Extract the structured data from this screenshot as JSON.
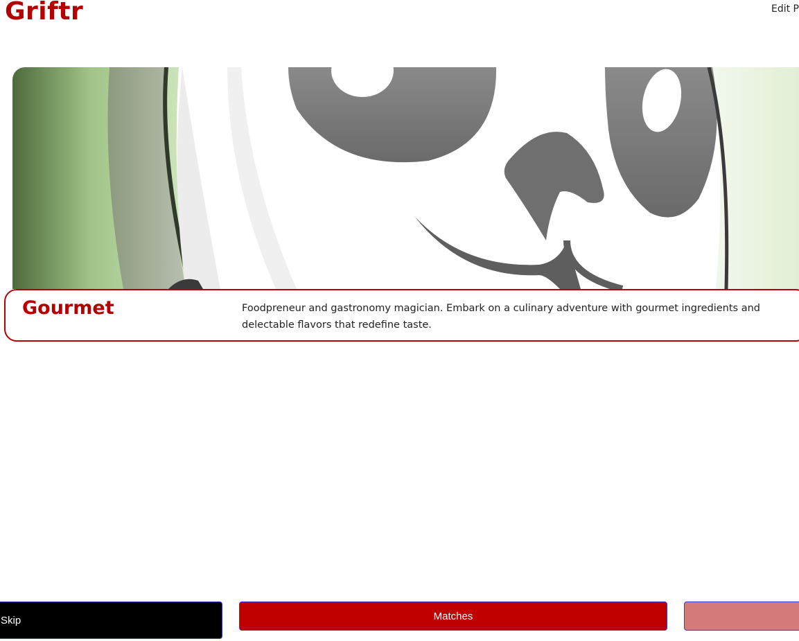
{
  "header": {
    "brand": "Griftr",
    "edit_link": "Edit P"
  },
  "hero": {
    "image_subject": "cartoon-panda-face"
  },
  "profile_card": {
    "name": "Gourmet",
    "description": "Foodpreneur and gastronomy magician. Embark on a culinary adventure with gourmet ingredients and delectable flavors that redefine taste."
  },
  "actions": {
    "skip_label": "Skip",
    "matches_label": "Matches",
    "third_label": ""
  },
  "colors": {
    "brand": "#b30000",
    "matches_button": "#c00000",
    "skip_button": "#000000",
    "third_button": "#d47a7a"
  }
}
